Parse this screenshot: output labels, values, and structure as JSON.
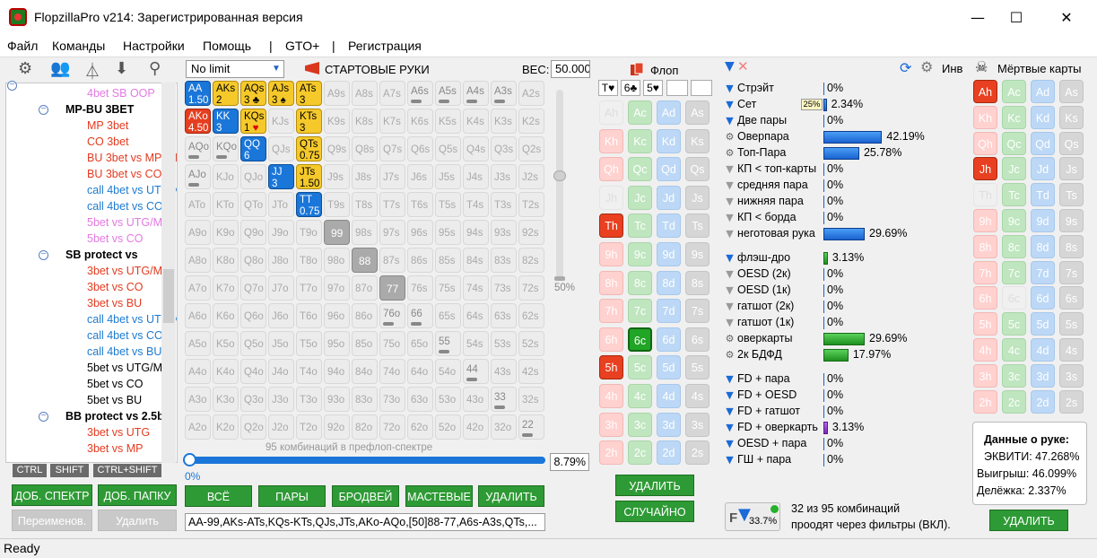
{
  "window": {
    "title": "FlopzillaPro v214: Зарегистрированная версия",
    "status": "Ready"
  },
  "menu": [
    {
      "label": "Файл"
    },
    {
      "label": "Команды"
    },
    {
      "label": "Настройки"
    },
    {
      "label": "Помощь"
    },
    {
      "label": "|"
    },
    {
      "label": "GTO+"
    },
    {
      "label": "|"
    },
    {
      "label": "Регистрация"
    }
  ],
  "tree": [
    {
      "label": "4bet SB OOP",
      "color": "#e37ae3",
      "indent": 2
    },
    {
      "label": "MP-BU 3BET",
      "color": "#000000",
      "indent": 1,
      "bold": true
    },
    {
      "label": "MP 3bet",
      "color": "#e33b20",
      "indent": 2
    },
    {
      "label": "CO 3bet",
      "color": "#e33b20",
      "indent": 2
    },
    {
      "label": "BU 3bet vs MP/UTG",
      "color": "#e33b20",
      "indent": 2
    },
    {
      "label": "BU 3bet vs CO",
      "color": "#e33b20",
      "indent": 2
    },
    {
      "label": "call 4bet vs UTG/MP",
      "color": "#1e7bd0",
      "indent": 2
    },
    {
      "label": "call 4bet vs CO",
      "color": "#1e7bd0",
      "indent": 2
    },
    {
      "label": "5bet vs UTG/MP",
      "color": "#e37ae3",
      "indent": 2
    },
    {
      "label": "5bet vs CO",
      "color": "#e37ae3",
      "indent": 2
    },
    {
      "label": "SB protect vs",
      "color": "#000000",
      "indent": 1,
      "bold": true
    },
    {
      "label": "3bet vs UTG/MP",
      "color": "#e33b20",
      "indent": 2
    },
    {
      "label": "3bet vs CO",
      "color": "#e33b20",
      "indent": 2
    },
    {
      "label": "3bet vs BU",
      "color": "#e33b20",
      "indent": 2
    },
    {
      "label": "call 4bet vs UTG/MP",
      "color": "#1e7bd0",
      "indent": 2
    },
    {
      "label": "call 4bet vs CO",
      "color": "#1e7bd0",
      "indent": 2
    },
    {
      "label": "call 4bet vs BU",
      "color": "#1e7bd0",
      "indent": 2
    },
    {
      "label": "5bet vs UTG/MP",
      "color": "#000000",
      "indent": 2
    },
    {
      "label": "5bet vs CO",
      "color": "#000000",
      "indent": 2
    },
    {
      "label": "5bet vs BU",
      "color": "#000000",
      "indent": 2
    },
    {
      "label": "BB protect vs 2.5bb",
      "color": "#000000",
      "indent": 1,
      "bold": true
    },
    {
      "label": "3bet vs UTG",
      "color": "#e33b20",
      "indent": 2
    },
    {
      "label": "3bet vs MP",
      "color": "#e33b20",
      "indent": 2
    }
  ],
  "left_buttons": {
    "ctrl": "CTRL",
    "shift": "SHIFT",
    "ctrl_shift": "CTRL+SHIFT",
    "add_range": "ДОБ. СПЕКТР",
    "add_folder": "ДОБ. ПАПКУ",
    "rename": "Переименов.",
    "delete": "Удалить"
  },
  "range": {
    "limit": "No limit",
    "hands_label": "СТАРТОВЫЕ РУКИ",
    "weight_label": "ВЕС:",
    "weight": "50.000",
    "slider_pct": "50%",
    "combos_label": "95 комбинаций в префлоп-спектре",
    "pct_left": "0%",
    "pct_right": "8.79%",
    "buttons": [
      "ВСЁ",
      "ПАРЫ",
      "БРОДВЕЙ",
      "МАСТЕВЫЕ",
      "УДАЛИТЬ"
    ],
    "text": "AA-99,AKs-ATs,KQs-KTs,QJs,JTs,AKo-AQo,[50]88-77,A6s-A3s,QTs,..."
  },
  "grid_ranks": [
    "A",
    "K",
    "Q",
    "J",
    "T",
    "9",
    "8",
    "7",
    "6",
    "5",
    "4",
    "3",
    "2"
  ],
  "grid_selected": {
    "AA": {
      "c": "blue",
      "w": "1.50"
    },
    "AKs": {
      "c": "yellow",
      "w": "2"
    },
    "AQs": {
      "c": "yellow",
      "w": "3",
      "suit": "♣"
    },
    "AJs": {
      "c": "yellow",
      "w": "3",
      "suit": "♠"
    },
    "ATs": {
      "c": "yellow",
      "w": "3"
    },
    "AKo": {
      "c": "red",
      "w": "4.50"
    },
    "KK": {
      "c": "blue",
      "w": "3"
    },
    "KQs": {
      "c": "yellow",
      "w": "1",
      "suit": "♥"
    },
    "KTs": {
      "c": "yellow",
      "w": "3"
    },
    "QQ": {
      "c": "blue",
      "w": "6"
    },
    "QTs": {
      "c": "yellow",
      "w": "0.75"
    },
    "JJ": {
      "c": "blue",
      "w": "3"
    },
    "JTs": {
      "c": "yellow",
      "w": "1.50"
    },
    "TT": {
      "c": "blue",
      "w": "0.75"
    },
    "99": {
      "c": "gray",
      "w": ""
    },
    "88": {
      "c": "gray",
      "w": ""
    },
    "77": {
      "c": "gray",
      "w": ""
    }
  },
  "grid_marked": [
    "A6s",
    "A5s",
    "A4s",
    "A3s",
    "AQo",
    "AJo",
    "KQo",
    "76o",
    "66",
    "55",
    "44",
    "33",
    "22"
  ],
  "flop": {
    "label": "Флоп",
    "board": [
      "T♥",
      "6♣",
      "5♥",
      "",
      ""
    ],
    "ranks": [
      "A",
      "K",
      "Q",
      "J",
      "T",
      "9",
      "8",
      "7",
      "6",
      "5",
      "4",
      "3",
      "2"
    ],
    "suits": [
      "h",
      "c",
      "d",
      "s"
    ],
    "selected": [
      "Th",
      "6c",
      "5h"
    ],
    "delete": "УДАЛИТЬ",
    "random": "СЛУЧАЙНО"
  },
  "filters": {
    "inv_label": "Инв",
    "rows": [
      {
        "label": "Стрэйт",
        "icon": "filter-blue",
        "val": "0%",
        "bar": 0,
        "kind": "blue"
      },
      {
        "label": "Сет",
        "icon": "filter-blue",
        "val": "2.34%",
        "bar": 2.34,
        "kind": "blue"
      },
      {
        "label": "Две пары",
        "icon": "filter-blue",
        "val": "0%",
        "bar": 0,
        "kind": "blue"
      },
      {
        "label": "Оверпара",
        "icon": "gear",
        "val": "42.19%",
        "bar": 42.19,
        "kind": "blue"
      },
      {
        "label": "Топ-Пара",
        "icon": "gear",
        "val": "25.78%",
        "bar": 25.78,
        "kind": "blue"
      },
      {
        "label": "КП < топ-карты",
        "icon": "filter-gray",
        "val": "0%",
        "bar": 0,
        "kind": "blue"
      },
      {
        "label": "средняя пара",
        "icon": "filter-gray",
        "val": "0%",
        "bar": 0,
        "kind": "blue"
      },
      {
        "label": "нижняя пара",
        "icon": "filter-gray",
        "val": "0%",
        "bar": 0,
        "kind": "blue"
      },
      {
        "label": "КП < борда",
        "icon": "filter-gray",
        "val": "0%",
        "bar": 0,
        "kind": "blue"
      },
      {
        "label": "неготовая рука",
        "icon": "filter-gray",
        "val": "29.69%",
        "bar": 29.69,
        "kind": "blue"
      },
      {
        "label": "флэш-дро",
        "icon": "filter-blue",
        "val": "3.13%",
        "bar": 3.13,
        "kind": "green"
      },
      {
        "label": "OESD (2к)",
        "icon": "filter-gray",
        "val": "0%",
        "bar": 0,
        "kind": "green"
      },
      {
        "label": "OESD (1к)",
        "icon": "filter-gray",
        "val": "0%",
        "bar": 0,
        "kind": "green"
      },
      {
        "label": "гатшот (2к)",
        "icon": "filter-gray",
        "val": "0%",
        "bar": 0,
        "kind": "green"
      },
      {
        "label": "гатшот (1к)",
        "icon": "filter-gray",
        "val": "0%",
        "bar": 0,
        "kind": "green"
      },
      {
        "label": "оверкарты",
        "icon": "gear",
        "val": "29.69%",
        "bar": 29.69,
        "kind": "green"
      },
      {
        "label": "2к БДФД",
        "icon": "gear",
        "val": "17.97%",
        "bar": 17.97,
        "kind": "green"
      },
      {
        "label": "FD + пара",
        "icon": "filter-blue",
        "val": "0%",
        "bar": 0,
        "kind": "purple"
      },
      {
        "label": "FD + OESD",
        "icon": "filter-blue",
        "val": "0%",
        "bar": 0,
        "kind": "purple"
      },
      {
        "label": "FD + гатшот",
        "icon": "filter-blue",
        "val": "0%",
        "bar": 0,
        "kind": "purple"
      },
      {
        "label": "FD + оверкарть",
        "icon": "filter-blue",
        "val": "3.13%",
        "bar": 3.13,
        "kind": "purple"
      },
      {
        "label": "OESD + пара",
        "icon": "filter-blue",
        "val": "0%",
        "bar": 0,
        "kind": "purple"
      },
      {
        "label": "ГШ + пара",
        "icon": "filter-blue",
        "val": "0%",
        "bar": 0,
        "kind": "purple"
      }
    ],
    "set_tooltip": "25%",
    "badge_pct": "33.7%",
    "summary_line1": "32 из 95 комбинаций",
    "summary_line2": "проодят через фильтры (ВКЛ)."
  },
  "dead": {
    "label": "Мёртвые карты",
    "selected": [
      "Ah",
      "Jh"
    ],
    "used": [
      "Th",
      "6c"
    ],
    "delete": "УДАЛИТЬ"
  },
  "hand_data": {
    "title": "Данные о руке:",
    "equity": "ЭКВИТИ: 47.268%",
    "win": "Выигрыш: 46.099%",
    "tie": "Делёжка: 2.337%"
  }
}
